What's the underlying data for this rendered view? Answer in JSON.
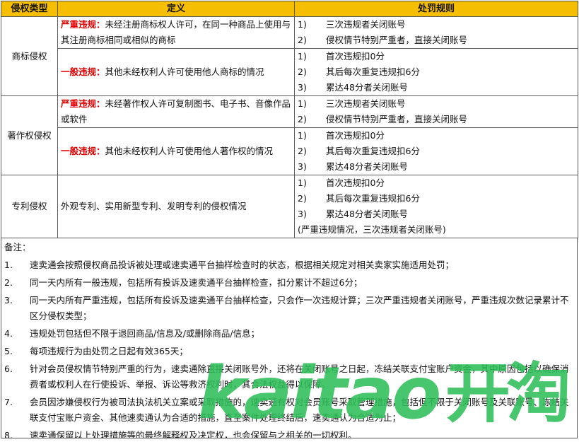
{
  "headers": {
    "type": "侵权类型",
    "definition": "定义",
    "penalty": "处罚规则"
  },
  "sections": [
    {
      "type": "商标侵权",
      "rows": [
        {
          "severity": "严重违规：",
          "text": "未经注册商标权人许可，在同一种商品上使用与其注册商标相同或相似的商标",
          "rules": [
            {
              "n": "1)",
              "t": "三次违规者关闭账号"
            },
            {
              "n": "2)",
              "t": "侵权情节特别严重者，直接关闭账号"
            }
          ]
        },
        {
          "severity": "一般违规：",
          "text": "其他未经权利人许可使用他人商标的情况",
          "rules": [
            {
              "n": "1)",
              "t": "首次违规扣0分"
            },
            {
              "n": "2)",
              "t": "其后每次重复违规扣6分"
            },
            {
              "n": "3)",
              "t": "累达48分者关闭账号"
            }
          ]
        }
      ]
    },
    {
      "type": "著作权侵权",
      "rows": [
        {
          "severity": "严重违规：",
          "text": "未经著作权人许可复制图书、电子书、音像作品或软件",
          "rules": [
            {
              "n": "1)",
              "t": "三次违规者关闭账号"
            },
            {
              "n": "2)",
              "t": "侵权情节特别严重者，直接关闭账号"
            }
          ]
        },
        {
          "severity": "一般违规：",
          "text": "其他未经权利人许可使用他人著作权的情况",
          "rules": [
            {
              "n": "1)",
              "t": "首次违规扣0分"
            },
            {
              "n": "2)",
              "t": "其后每次重复违规扣6分"
            },
            {
              "n": "3)",
              "t": "累达48分者关闭账号"
            }
          ]
        }
      ]
    },
    {
      "type": "专利侵权",
      "rows": [
        {
          "severity": "",
          "text": "外观专利、实用新型专利、发明专利的侵权情况",
          "rules": [
            {
              "n": "1)",
              "t": "首次违规扣0分"
            },
            {
              "n": "2)",
              "t": "其后每次重复违规扣6分"
            },
            {
              "n": "3)",
              "t": "累达48分者关闭账号"
            }
          ],
          "extra": "(严重违规情况，三次违规者关闭账号)"
        }
      ]
    }
  ],
  "notes": {
    "title": "备注：",
    "items": [
      {
        "n": "1.",
        "t": "速卖通会按照侵权商品投诉被处理或速卖通平台抽样检查时的状态，根据相关规定对相关卖家实施适用处罚；"
      },
      {
        "n": "2.",
        "t": "同一天内所有一般违规，包括所有投诉及速卖通平台抽样检查，扣分累计不超过6分；"
      },
      {
        "n": "3.",
        "t": "同一天内所有严重违规，包括所有投诉及速卖通平台抽样检查，只会作一次违规计算；三次严重违规者关闭账号，严重违规次数记录累计不区分侵权类型；"
      },
      {
        "n": "4.",
        "t": "违规处罚包括但不限于退回商品/信息及/或删除商品/信息；"
      },
      {
        "n": "5.",
        "t": "每项违规行为由处罚之日起有效365天；"
      },
      {
        "n": "6.",
        "t": "针对会员侵权情节特别严重的行为，速卖通除直接关闭账号外，还将在关闭账号之日起，冻结关联支付宝账户资金，其中原因包括以确保消费者或权利人在行使投诉、举报、诉讼等救济权利时，其合法权益得以保障。"
      },
      {
        "n": "7.",
        "t": "会员因涉嫌侵权行为被司法执法机关立案或采取措施的，速卖通有权对会员账号采取管理措施，包括但不限于关闭账号及关联账号、冻结关联支付宝账户资金、其他速卖通认为合适的措施，直至案件处理终结后，速卖通认为合适为止；"
      },
      {
        "n": "8.",
        "t": "速卖通保留以上处理措施等的最终解释权及决定权，也会保留与之相关的一切权利。"
      }
    ]
  },
  "watermark": {
    "latin": "kaitao",
    "cn": "开淘"
  }
}
